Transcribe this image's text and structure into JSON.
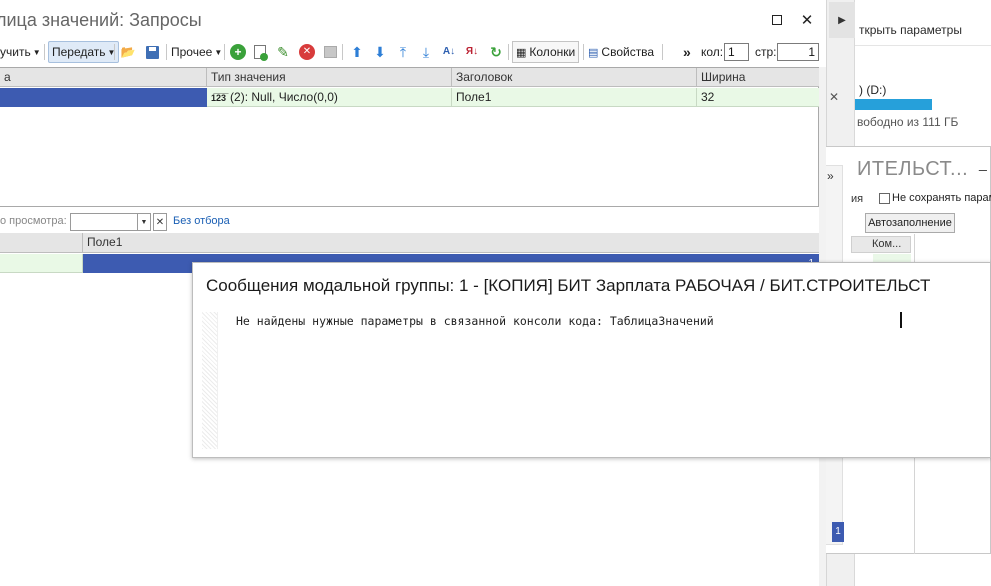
{
  "main_window": {
    "title": "лица значений: Запросы",
    "maximize_label": "☐",
    "close_label": "✕"
  },
  "toolbar": {
    "receive_label": "учить",
    "send_label": "Передать",
    "other_label": "Прочее",
    "columns_label": "Колонки",
    "properties_label": "Свойства",
    "cols_label": "кол:",
    "cols_value": "1",
    "page_label": "стр:",
    "page_value": "1",
    "more_label": "»"
  },
  "grid1": {
    "columns": [
      "а",
      "Тип значения",
      "Заголовок",
      "Ширина"
    ],
    "row": {
      "type_icon": "1̅2̅3̅",
      "type_value": "(2): Null, Число(0,0)",
      "header": "Поле1",
      "width": "32"
    }
  },
  "filter_bar": {
    "view_label": "о просмотра:",
    "filter_value": "",
    "clear_label": "✕",
    "no_filter_link": "Без отбора"
  },
  "grid2": {
    "column": "Поле1",
    "row_value": "1"
  },
  "right_window": {
    "open_params": "ткрыть параметры",
    "disk_label": ") (D:)",
    "disk_used_fraction": 1.0,
    "disk_free": "вободно из 111 ГБ",
    "side_x": "✕"
  },
  "bg_dialog": {
    "title": "ИТЕЛЬСТ...",
    "minimize": "_",
    "text_fragment": "ия",
    "checkbox_label": "Не сохранять парам",
    "autofill_label": "Автозаполнение",
    "grid_header": "Ком...",
    "selected_value": "1"
  },
  "message_popup": {
    "title": "Сообщения модальной группы: 1 - [КОПИЯ] БИТ Зарплата РАБОЧАЯ / БИТ.СТРОИТЕЛЬСТ",
    "message": "Не найдены нужные параметры в связанной консоли кода: ТаблицаЗначений"
  },
  "colors": {
    "selection_blue": "#3d5bb1",
    "row_green": "#e9f9e6",
    "link_blue": "#1a5fb4",
    "disk_bar_blue": "#26a0da"
  }
}
